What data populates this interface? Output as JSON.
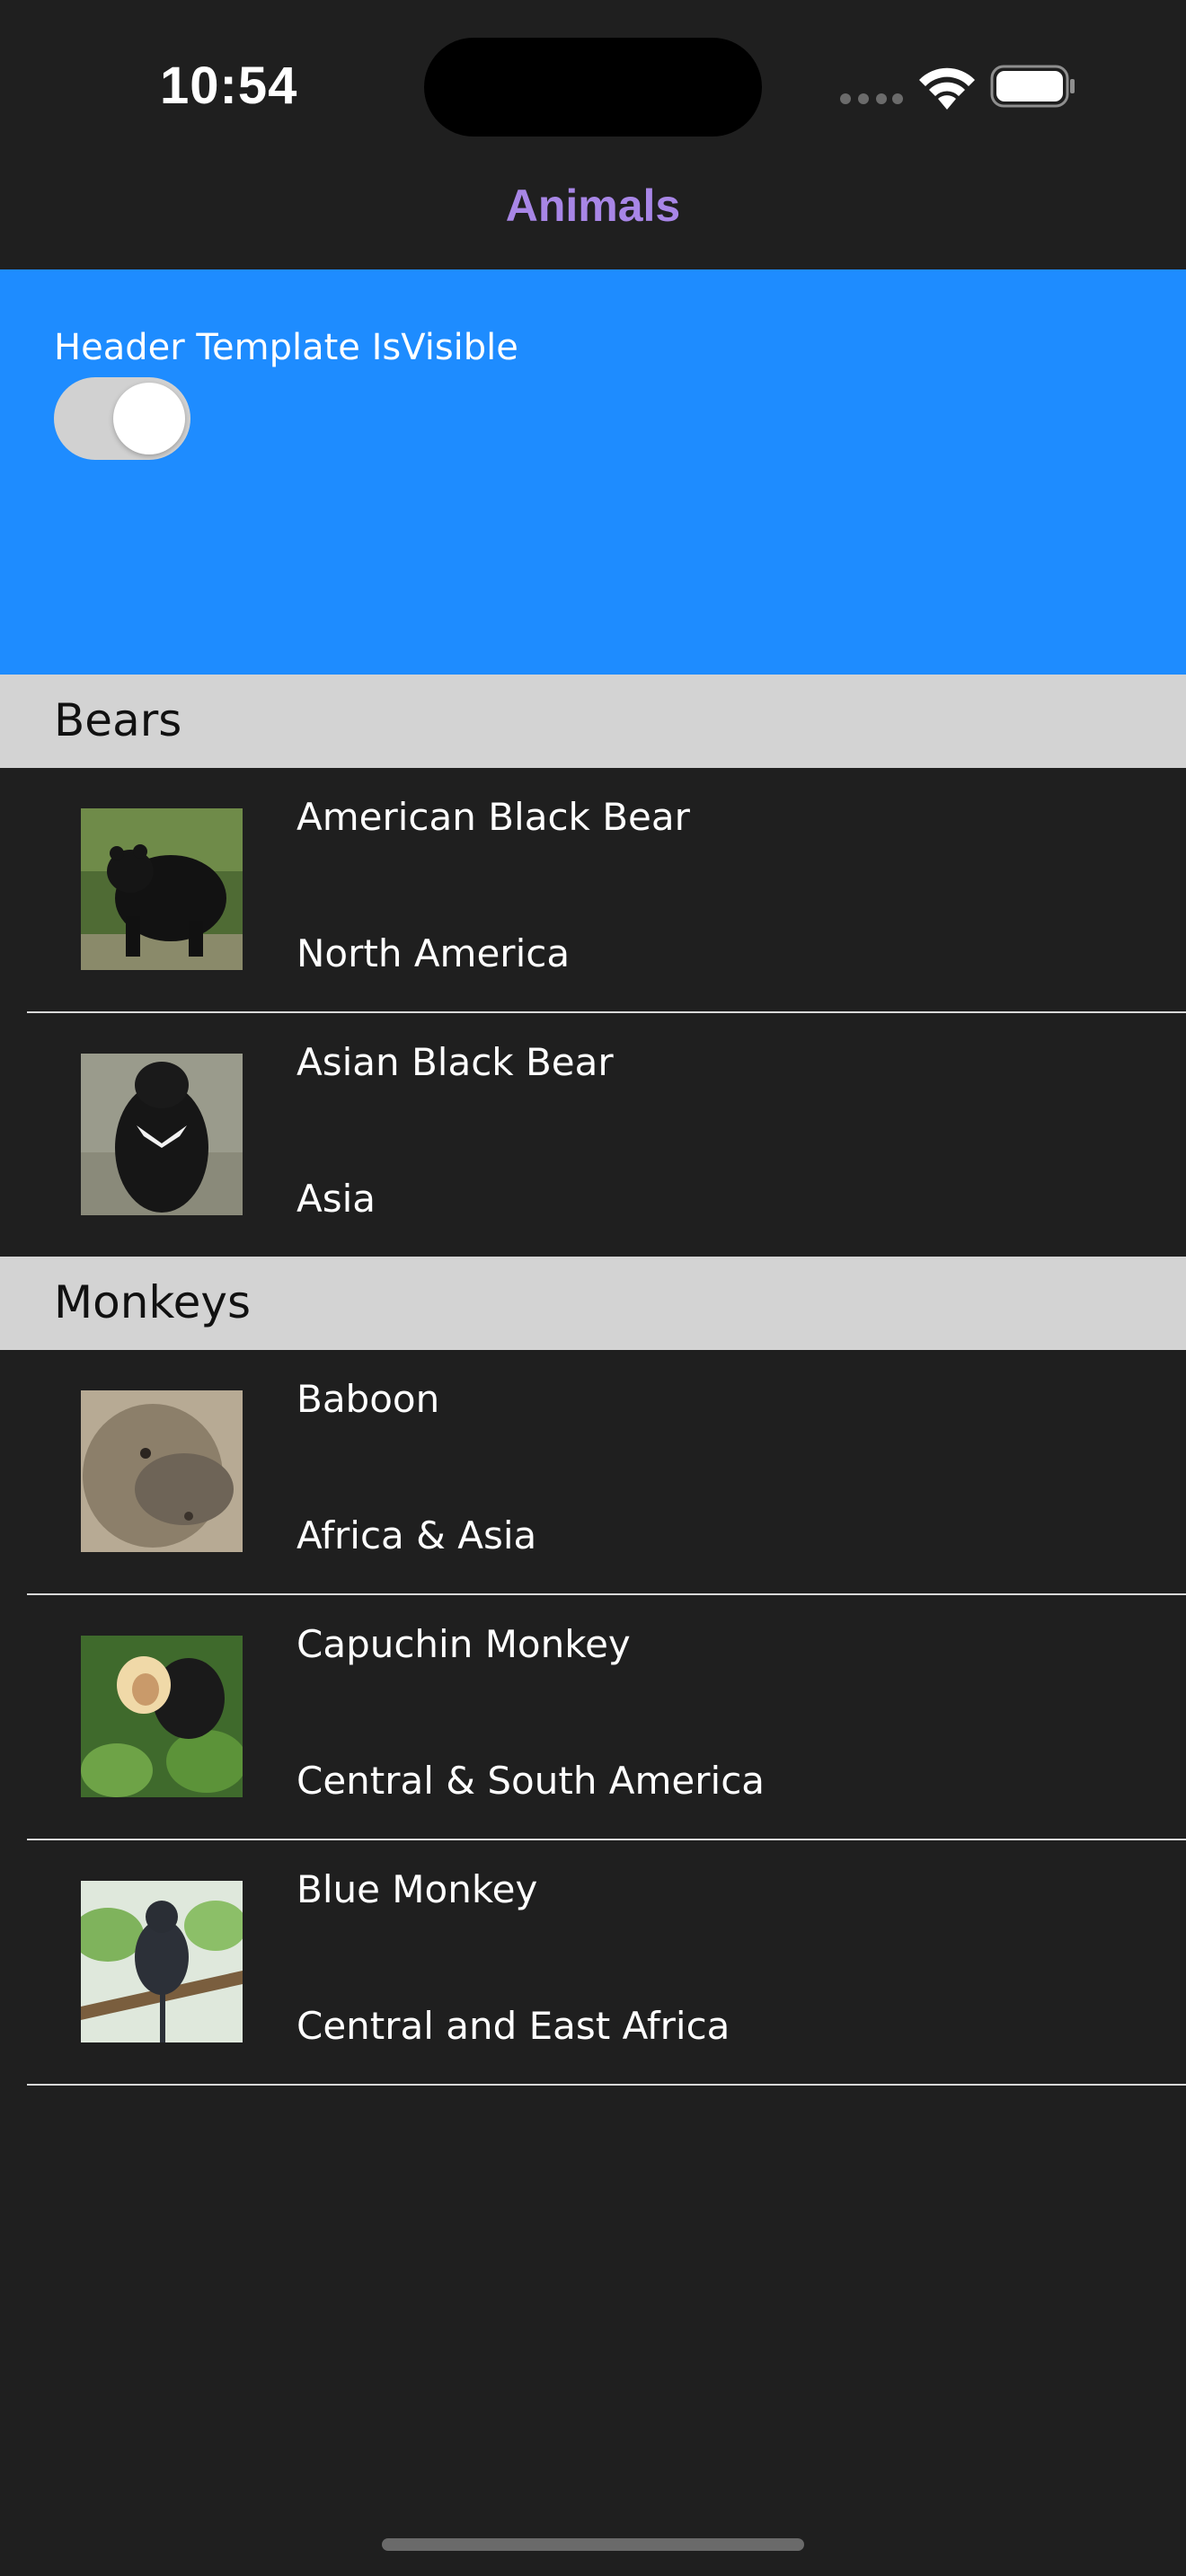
{
  "status_bar": {
    "time": "10:54"
  },
  "nav": {
    "title": "Animals"
  },
  "header": {
    "label": "Header Template IsVisible",
    "toggle_on": true
  },
  "groups": [
    {
      "name": "Bears",
      "items": [
        {
          "name": "American Black Bear",
          "location": "North America"
        },
        {
          "name": "Asian Black Bear",
          "location": "Asia"
        }
      ]
    },
    {
      "name": "Monkeys",
      "items": [
        {
          "name": "Baboon",
          "location": "Africa & Asia"
        },
        {
          "name": "Capuchin Monkey",
          "location": "Central & South America"
        },
        {
          "name": "Blue Monkey",
          "location": "Central and East Africa"
        }
      ]
    }
  ],
  "colors": {
    "background": "#1f1f1f",
    "nav_title": "#a886e6",
    "header_bg": "#1e8cff",
    "group_header_bg": "#d3d3d3",
    "toggle_track": "#d1d1d1"
  }
}
